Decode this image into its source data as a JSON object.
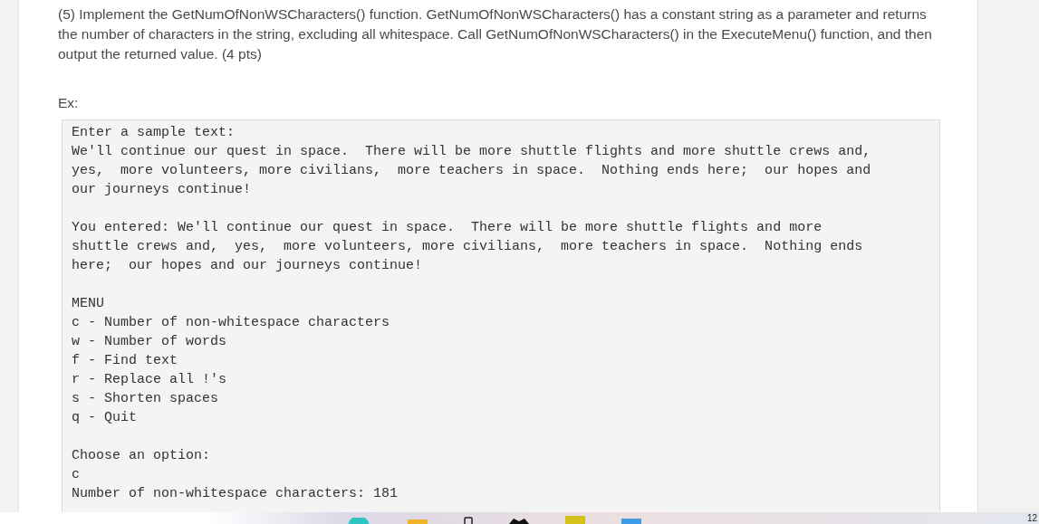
{
  "question": {
    "text": "(5) Implement the GetNumOfNonWSCharacters() function. GetNumOfNonWSCharacters() has a constant string as a parameter and returns the number of characters in the string, excluding all whitespace. Call GetNumOfNonWSCharacters() in the ExecuteMenu() function, and then output the returned value. (4 pts)"
  },
  "example_label": "Ex:",
  "console": {
    "blocks": [
      [
        "Enter a sample text:",
        "We'll continue our quest in space.  There will be more shuttle flights and more shuttle crews and,",
        "yes,  more volunteers, more civilians,  more teachers in space.  Nothing ends here;  our hopes and",
        "our journeys continue!"
      ],
      [
        "You entered: We'll continue our quest in space.  There will be more shuttle flights and more",
        "shuttle crews and,  yes,  more volunteers, more civilians,  more teachers in space.  Nothing ends",
        "here;  our hopes and our journeys continue!"
      ],
      [
        "MENU",
        "c - Number of non-whitespace characters",
        "w - Number of words",
        "f - Find text",
        "r - Replace all !'s",
        "s - Shorten spaces",
        "q - Quit"
      ],
      [
        "Choose an option:",
        "c",
        "Number of non-whitespace characters: 181"
      ]
    ]
  },
  "taskbar": {
    "clock": "12"
  }
}
